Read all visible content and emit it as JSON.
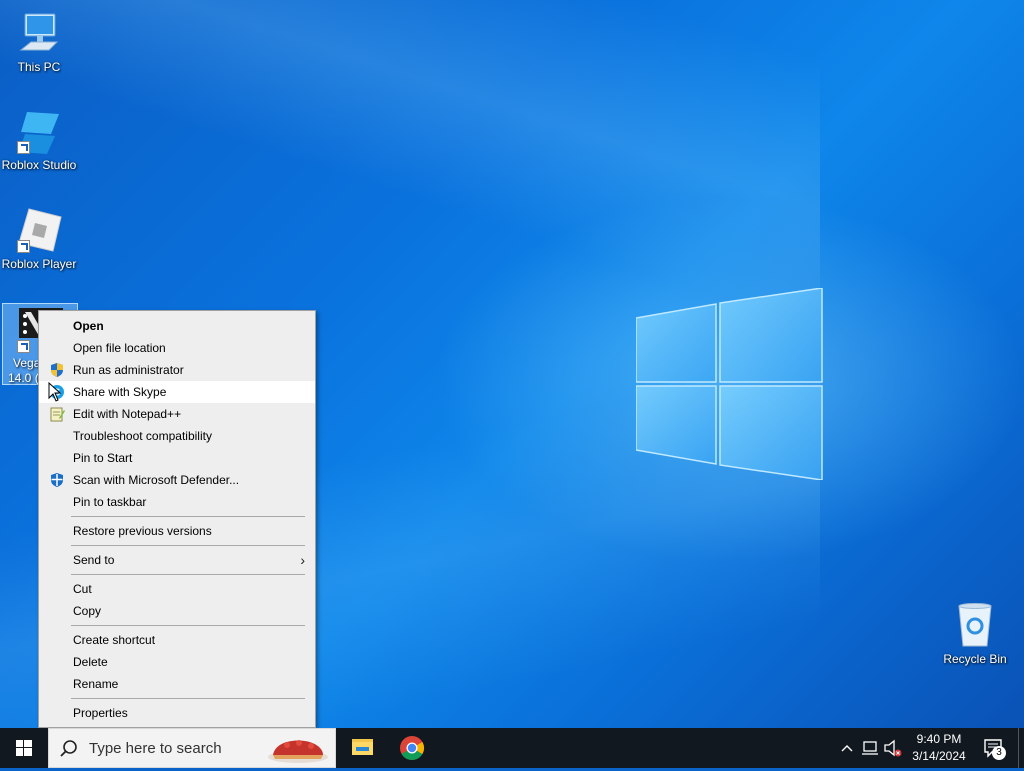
{
  "desktop": {
    "icons": [
      {
        "label": "This PC"
      },
      {
        "label": "Roblox Studio"
      },
      {
        "label": "Roblox Player"
      },
      {
        "label": "Vega",
        "label2": "14.0 ("
      },
      {
        "label": "Recycle Bin"
      }
    ]
  },
  "context_menu": {
    "items": [
      {
        "label": "Open",
        "bold": true
      },
      {
        "label": "Open file location"
      },
      {
        "label": "Run as administrator",
        "icon": "uac-shield-icon"
      },
      {
        "label": "Share with Skype",
        "icon": "skype-share-icon",
        "highlighted": true
      },
      {
        "label": "Edit with Notepad++",
        "icon": "notepadpp-icon"
      },
      {
        "label": "Troubleshoot compatibility"
      },
      {
        "label": "Pin to Start"
      },
      {
        "label": "Scan with Microsoft Defender...",
        "icon": "defender-icon"
      },
      {
        "label": "Pin to taskbar"
      },
      {
        "label": "Restore previous versions"
      },
      {
        "label": "Send to",
        "submenu": true
      },
      {
        "label": "Cut"
      },
      {
        "label": "Copy"
      },
      {
        "label": "Create shortcut"
      },
      {
        "label": "Delete"
      },
      {
        "label": "Rename"
      },
      {
        "label": "Properties"
      }
    ]
  },
  "taskbar": {
    "search_placeholder": "Type here to search",
    "pinned_apps": [
      "file-explorer-icon",
      "chrome-icon"
    ],
    "clock_time": "9:40 PM",
    "clock_date": "3/14/2024",
    "notification_count": "3"
  },
  "colors": {
    "taskbar_bg": "#111820",
    "menu_bg": "#eeeeee",
    "menu_highlight": "#ffffff",
    "desktop_blue": "#0a72dd"
  }
}
